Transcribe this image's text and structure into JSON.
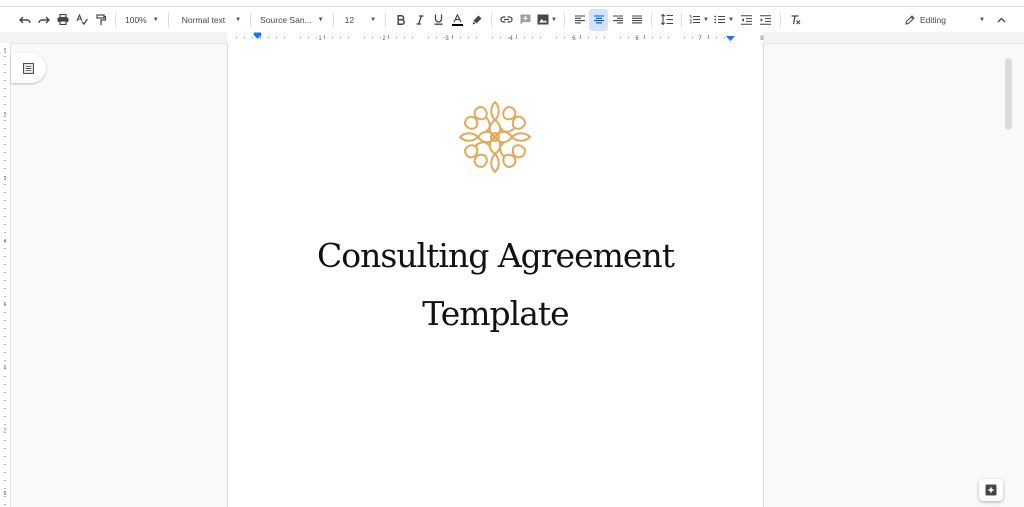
{
  "toolbar": {
    "zoom": "100%",
    "style": "Normal text",
    "font": "Source San...",
    "font_size": "12",
    "mode": "Editing"
  },
  "ruler": {
    "numbers": [
      "1",
      "2",
      "3",
      "4",
      "5",
      "6",
      "7",
      "8"
    ],
    "vnumbers": [
      "1",
      "2",
      "3",
      "4",
      "5",
      "6",
      "7",
      "8"
    ]
  },
  "document": {
    "title_line1": "Consulting Agreement",
    "title_line2": "Template",
    "logo_color": "#e0a95b"
  },
  "colors": {
    "accent": "#1a73e8",
    "active_bg": "#d3e3fd"
  }
}
